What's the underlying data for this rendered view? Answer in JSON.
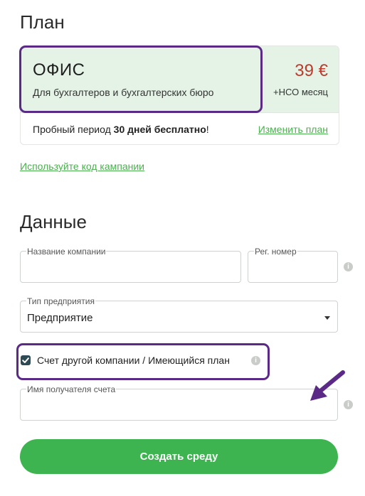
{
  "plan_section": {
    "title": "План",
    "plan": {
      "name": "ОФИС",
      "description": "Для бухгалтеров и бухгалтерских бюро",
      "price": "39 €",
      "period": "+НСО месяц"
    },
    "trial": {
      "prefix": "Пробный период ",
      "bold": "30 дней бесплатно",
      "suffix": "!"
    },
    "change_plan_label": "Изменить план",
    "campaign_code_label": "Используйте код кампании"
  },
  "data_section": {
    "title": "Данные",
    "company_name": {
      "label": "Название компании",
      "value": ""
    },
    "reg_number": {
      "label": "Рег. номер",
      "value": ""
    },
    "enterprise_type": {
      "label": "Тип предприятия",
      "value": "Предприятие"
    },
    "other_company_checkbox": {
      "label": "Счет другой компании / Имеющийся план",
      "checked": true
    },
    "invoice_recipient": {
      "label": "Имя получателя счета",
      "value": ""
    }
  },
  "submit_label": "Создать среду",
  "colors": {
    "accent_green": "#3db450",
    "link_green": "#4caf50",
    "price_red": "#c0392b",
    "highlight_purple": "#5b2a86",
    "plan_bg": "#e4f3e6"
  },
  "icons": [
    "info-icon",
    "check-icon",
    "caret-down-icon",
    "arrow-annotation-icon"
  ]
}
